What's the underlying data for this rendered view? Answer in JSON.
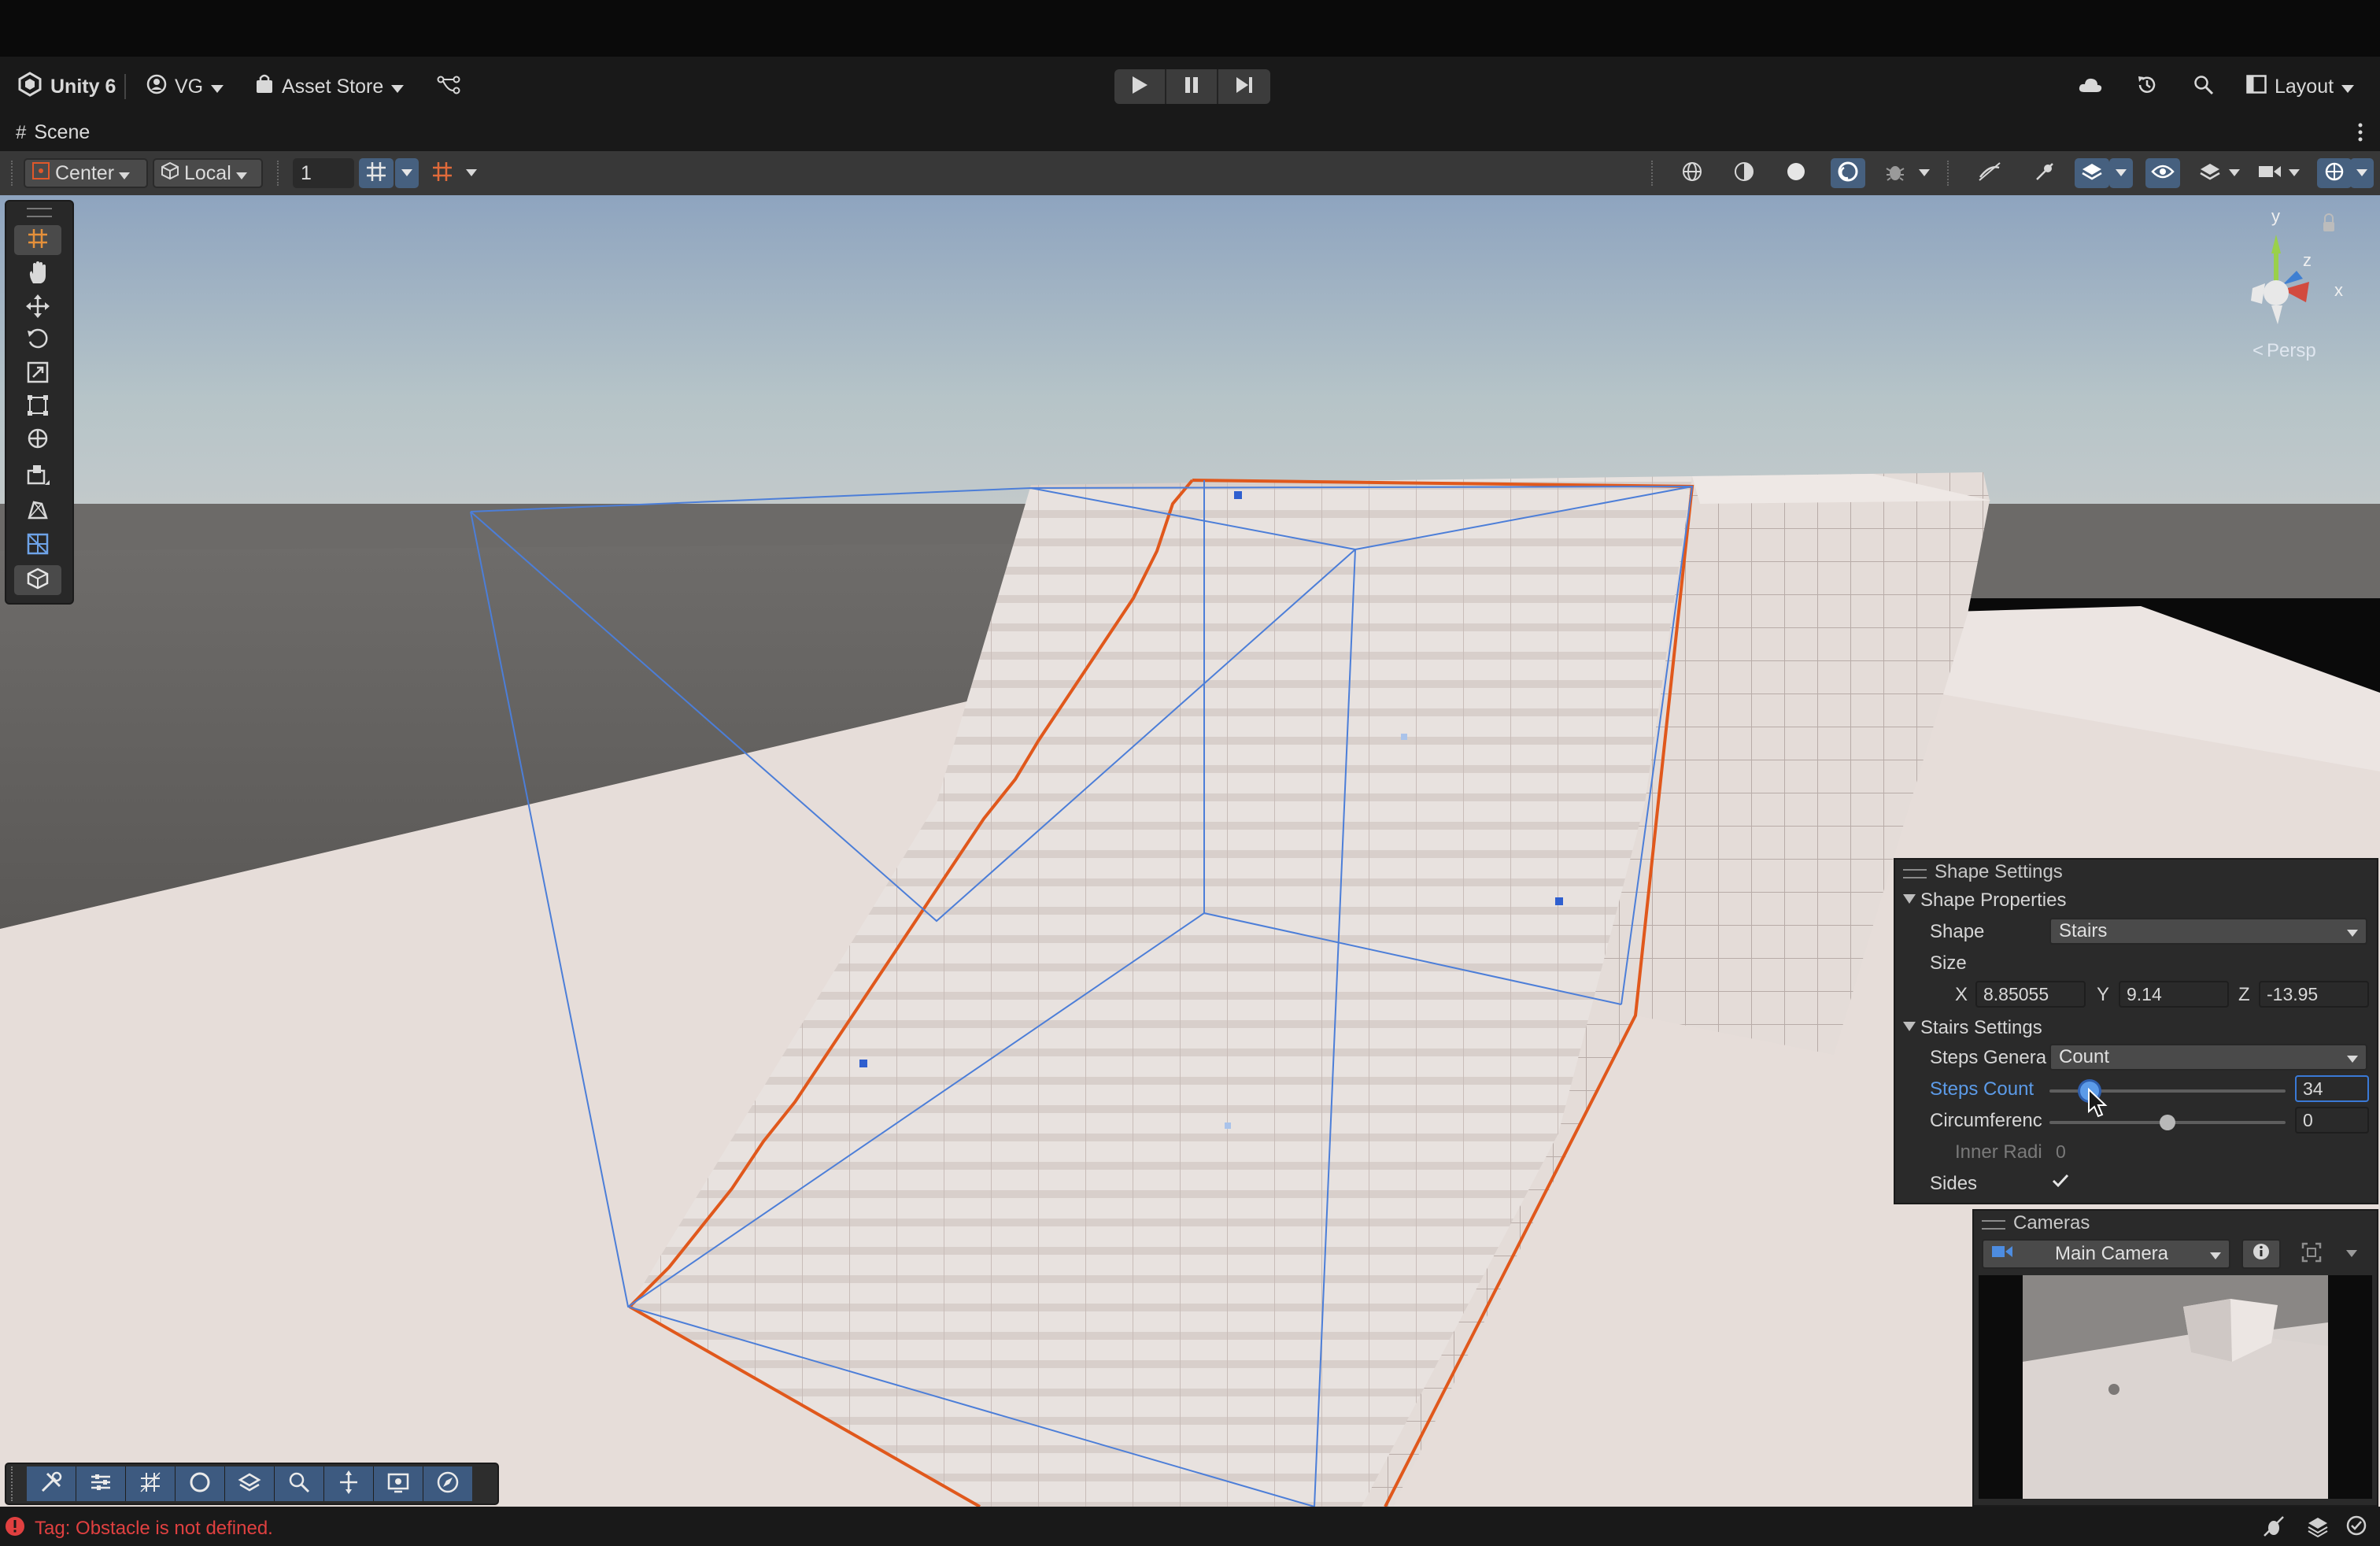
{
  "header": {
    "app_title": "Unity 6",
    "account_label": "VG",
    "asset_store_label": "Asset Store",
    "layout_label": "Layout"
  },
  "scene_tab": {
    "label": "Scene"
  },
  "scene_toolbar": {
    "pivot_label": "Center",
    "space_label": "Local",
    "snap_value": "1"
  },
  "gizmo": {
    "y_label": "y",
    "x_label": "x",
    "z_label": "z",
    "persp_label": "Persp"
  },
  "shape_settings": {
    "title": "Shape Settings",
    "shape_properties_header": "Shape Properties",
    "shape_label": "Shape",
    "shape_value": "Stairs",
    "size_label": "Size",
    "size_x_label": "X",
    "size_x": "8.85055",
    "size_y_label": "Y",
    "size_y": "9.14",
    "size_z_label": "Z",
    "size_z": "-13.95",
    "stairs_settings_header": "Stairs Settings",
    "steps_generation_label": "Steps Genera",
    "steps_generation_value": "Count",
    "steps_count_label": "Steps Count",
    "steps_count_value": "34",
    "steps_count_slider": 0.17,
    "circumference_label": "Circumferenc",
    "circumference_value": "0",
    "circumference_slider": 0.5,
    "inner_radius_label": "Inner Radi",
    "inner_radius_value": "0",
    "sides_label": "Sides",
    "sides_checked": true
  },
  "cameras": {
    "title": "Cameras",
    "camera_value": "Main Camera"
  },
  "status": {
    "message": "Tag: Obstacle is not defined.",
    "error_color": "#e04040"
  },
  "colors": {
    "accent": "#3a79d6",
    "selection_outline": "#e0581c"
  }
}
